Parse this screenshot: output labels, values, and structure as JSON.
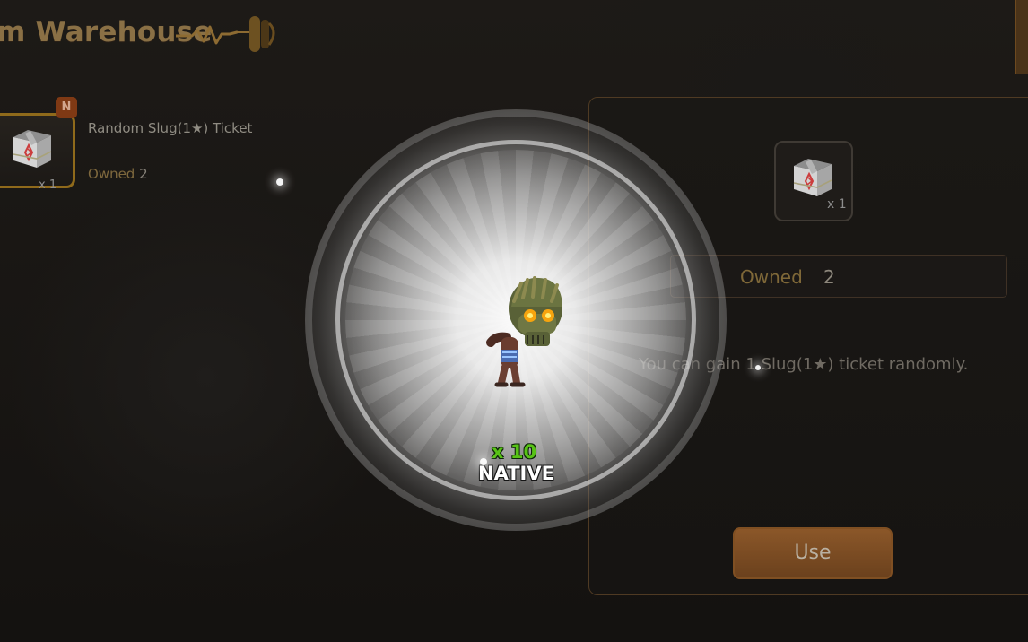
{
  "header": {
    "title": "m Warehouse"
  },
  "inventory": {
    "items": [
      {
        "name": "Random Slug(1★) Ticket",
        "owned_label": "Owned",
        "owned_value": "2",
        "quantity": "x 1",
        "badge": "N",
        "icon": "crate-icon"
      }
    ]
  },
  "detail": {
    "icon": "crate-icon",
    "quantity": "x 1",
    "owned_label": "Owned",
    "owned_value": "2",
    "description": "You can gain 1 Slug(1★) ticket randomly.",
    "use_label": "Use"
  },
  "reward": {
    "count": "x 10",
    "name": "NATIVE",
    "character_icon": "native-character-icon"
  },
  "colors": {
    "accent_gold": "#8f6a1b",
    "button_orange": "#8b5729",
    "reward_green": "#58c316"
  }
}
